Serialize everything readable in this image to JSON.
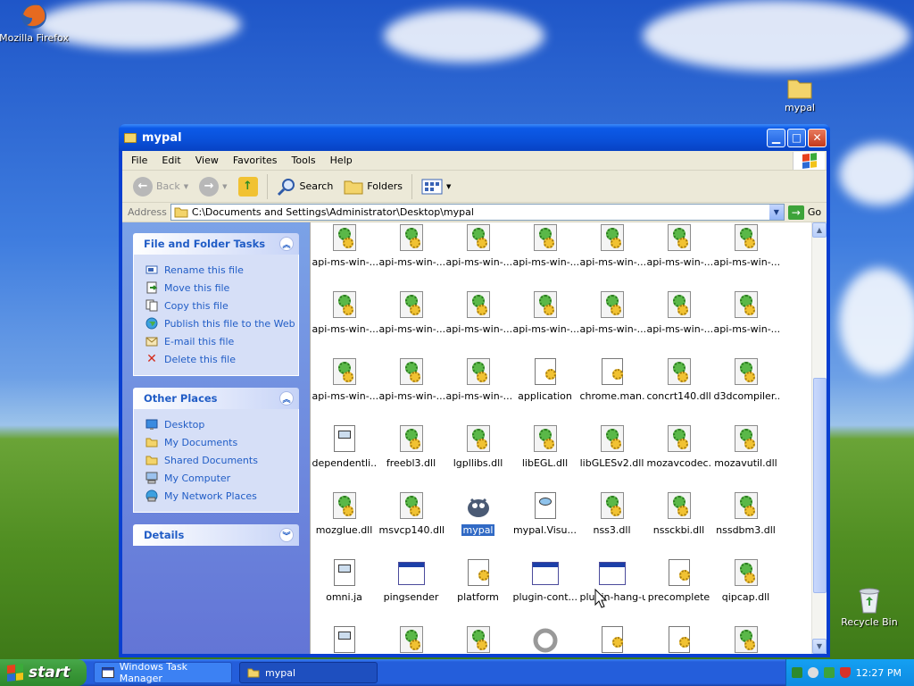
{
  "desktop": {
    "icons": [
      {
        "label": "Mozilla Firefox",
        "icon": "firefox-icon"
      },
      {
        "label": "mypal",
        "icon": "folder-icon"
      },
      {
        "label": "Recycle Bin",
        "icon": "recycle-bin-icon"
      }
    ]
  },
  "window": {
    "title": "mypal",
    "menu": [
      "File",
      "Edit",
      "View",
      "Favorites",
      "Tools",
      "Help"
    ],
    "toolbar": {
      "back": "Back",
      "search": "Search",
      "folders": "Folders"
    },
    "address": {
      "label": "Address",
      "path": "C:\\Documents and Settings\\Administrator\\Desktop\\mypal",
      "go": "Go"
    },
    "tasks": {
      "title": "File and Folder Tasks",
      "items": [
        "Rename this file",
        "Move this file",
        "Copy this file",
        "Publish this file to the Web",
        "E-mail this file",
        "Delete this file"
      ]
    },
    "places": {
      "title": "Other Places",
      "items": [
        "Desktop",
        "My Documents",
        "Shared Documents",
        "My Computer",
        "My Network Places"
      ]
    },
    "details": {
      "title": "Details"
    },
    "files": [
      [
        "api-ms-win-...",
        "api-ms-win-...",
        "api-ms-win-...",
        "api-ms-win-...",
        "api-ms-win-...",
        "api-ms-win-...",
        "api-ms-win-..."
      ],
      [
        "api-ms-win-...",
        "api-ms-win-...",
        "api-ms-win-...",
        "api-ms-win-...",
        "api-ms-win-...",
        "api-ms-win-...",
        "api-ms-win-..."
      ],
      [
        "api-ms-win-...",
        "api-ms-win-...",
        "api-ms-win-...",
        "application",
        "chrome.man...",
        "concrt140.dll",
        "d3dcompiler..."
      ],
      [
        "dependentli...",
        "freebl3.dll",
        "lgpllibs.dll",
        "libEGL.dll",
        "libGLESv2.dll",
        "mozavcodec...",
        "mozavutil.dll"
      ],
      [
        "mozglue.dll",
        "msvcp140.dll",
        "mypal",
        "mypal.Visu...",
        "nss3.dll",
        "nssckbi.dll",
        "nssdbm3.dll"
      ],
      [
        "omni.ja",
        "pingsender",
        "platform",
        "plugin-cont...",
        "plugin-hang-ui",
        "precomplete",
        "qipcap.dll"
      ]
    ],
    "selected": "mypal"
  },
  "taskbar": {
    "start": "start",
    "tasks": [
      "Windows Task Manager",
      "mypal"
    ],
    "clock": "12:27 PM"
  }
}
